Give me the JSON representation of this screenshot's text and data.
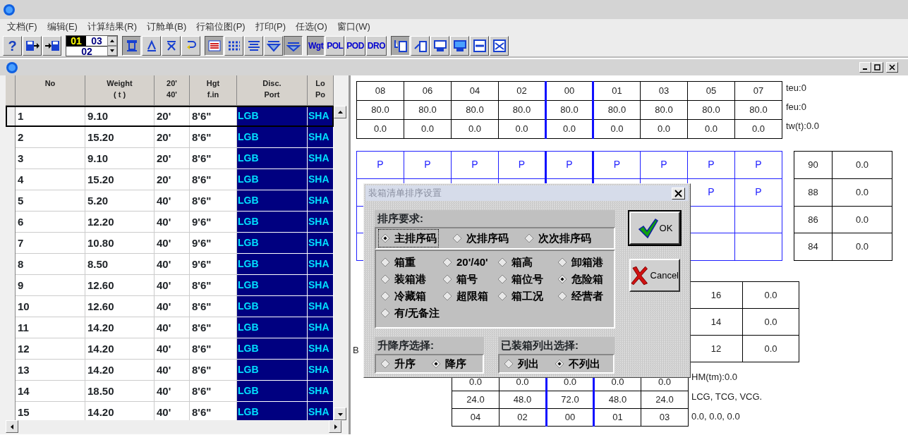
{
  "menu": [
    {
      "label": "文档(F)"
    },
    {
      "label": "编辑(E)"
    },
    {
      "label": "计算结果(R)"
    },
    {
      "label": "订舱单(B)"
    },
    {
      "label": "行箱位图(P)"
    },
    {
      "label": "打印(P)"
    },
    {
      "label": "任选(O)"
    },
    {
      "label": "窗口(W)"
    }
  ],
  "toolbar": [
    {
      "buttons": [
        {
          "kind": "text",
          "label": "?",
          "pressed": false
        },
        {
          "kind": "icon",
          "pressed": false
        },
        {
          "kind": "icon",
          "pressed": false
        }
      ]
    },
    {
      "spinner": {
        "first": "01",
        "second": "03",
        "third": "02"
      }
    },
    {
      "buttons": [
        {
          "kind": "icon",
          "pressed": true
        },
        {
          "kind": "icon",
          "pressed": false
        },
        {
          "kind": "icon",
          "pressed": false
        },
        {
          "kind": "icon",
          "pressed": false
        }
      ]
    },
    {
      "buttons": [
        {
          "kind": "icon",
          "pressed": true
        },
        {
          "kind": "icon",
          "pressed": false
        },
        {
          "kind": "icon",
          "pressed": false
        },
        {
          "kind": "icon",
          "pressed": false
        },
        {
          "kind": "icon",
          "pressed": true
        }
      ]
    },
    {
      "buttons": [
        {
          "kind": "text",
          "label": "Wgt",
          "pressed": true
        },
        {
          "kind": "text",
          "label": "POL",
          "pressed": false
        },
        {
          "kind": "text",
          "label": "POD",
          "pressed": false
        },
        {
          "kind": "text",
          "label": "DRO",
          "pressed": false
        }
      ]
    },
    {
      "buttons": [
        {
          "kind": "icon",
          "pressed": true
        },
        {
          "kind": "icon",
          "pressed": false
        },
        {
          "kind": "icon",
          "pressed": false
        },
        {
          "kind": "icon",
          "pressed": false
        },
        {
          "kind": "icon",
          "pressed": false
        },
        {
          "kind": "icon",
          "pressed": false
        }
      ]
    }
  ],
  "table": {
    "columns": [
      "No",
      "Weight\n( t )",
      "20'\n40'",
      "Hgt\nf.in",
      "Disc.\nPort",
      "Lo\nPo"
    ],
    "rows": [
      {
        "selected": true,
        "cells": [
          "1",
          "9.10",
          "20'",
          "8'6\"",
          "LGB",
          "SHA"
        ]
      },
      {
        "selected": false,
        "cells": [
          "2",
          "15.20",
          "20'",
          "8'6\"",
          "LGB",
          "SHA"
        ]
      },
      {
        "selected": false,
        "cells": [
          "3",
          "9.10",
          "20'",
          "8'6\"",
          "LGB",
          "SHA"
        ]
      },
      {
        "selected": false,
        "cells": [
          "4",
          "15.20",
          "20'",
          "8'6\"",
          "LGB",
          "SHA"
        ]
      },
      {
        "selected": false,
        "cells": [
          "5",
          "5.20",
          "40'",
          "8'6\"",
          "LGB",
          "SHA"
        ]
      },
      {
        "selected": false,
        "cells": [
          "6",
          "12.20",
          "40'",
          "9'6\"",
          "LGB",
          "SHA"
        ]
      },
      {
        "selected": false,
        "cells": [
          "7",
          "10.80",
          "40'",
          "9'6\"",
          "LGB",
          "SHA"
        ]
      },
      {
        "selected": false,
        "cells": [
          "8",
          "8.50",
          "40'",
          "9'6\"",
          "LGB",
          "SHA"
        ]
      },
      {
        "selected": false,
        "cells": [
          "9",
          "12.60",
          "40'",
          "8'6\"",
          "LGB",
          "SHA"
        ]
      },
      {
        "selected": false,
        "cells": [
          "10",
          "12.60",
          "40'",
          "8'6\"",
          "LGB",
          "SHA"
        ]
      },
      {
        "selected": false,
        "cells": [
          "11",
          "14.20",
          "40'",
          "8'6\"",
          "LGB",
          "SHA"
        ]
      },
      {
        "selected": false,
        "cells": [
          "12",
          "14.20",
          "40'",
          "8'6\"",
          "LGB",
          "SHA"
        ]
      },
      {
        "selected": false,
        "cells": [
          "13",
          "14.20",
          "40'",
          "8'6\"",
          "LGB",
          "SHA"
        ]
      },
      {
        "selected": false,
        "cells": [
          "14",
          "18.50",
          "40'",
          "8'6\"",
          "LGB",
          "SHA"
        ]
      },
      {
        "selected": false,
        "cells": [
          "15",
          "14.20",
          "40'",
          "8'6\"",
          "LGB",
          "SHA"
        ]
      }
    ]
  },
  "bay_plan": {
    "top_table": [
      [
        "08",
        "06",
        "04",
        "02",
        "00",
        "01",
        "03",
        "05",
        "07"
      ],
      [
        "80.0",
        "80.0",
        "80.0",
        "80.0",
        "80.0",
        "80.0",
        "80.0",
        "80.0",
        "80.0"
      ],
      [
        "0.0",
        "0.0",
        "0.0",
        "0.0",
        "0.0",
        "0.0",
        "0.0",
        "0.0",
        "0.0"
      ]
    ],
    "totals": [
      "teu:0",
      "feu:0",
      "tw(t):0.0"
    ],
    "slot_grid": [
      [
        "P",
        "P",
        "P",
        "P",
        "P",
        "P",
        "P",
        "P",
        "P"
      ],
      [
        "P",
        "P"
      ]
    ],
    "tier_table": [
      [
        "90",
        "0.0"
      ],
      [
        "88",
        "0.0"
      ],
      [
        "86",
        "0.0"
      ],
      [
        "84",
        "0.0"
      ]
    ],
    "lower_tier_table": [
      [
        "16",
        "0.0"
      ],
      [
        "14",
        "0.0"
      ],
      [
        "12",
        "0.0"
      ]
    ],
    "stray_text": "B",
    "bottom_table": [
      [
        "0.0",
        "0.0",
        "0.0",
        "0.0",
        "0.0"
      ],
      [
        "24.0",
        "48.0",
        "72.0",
        "48.0",
        "24.0"
      ],
      [
        "04",
        "02",
        "00",
        "01",
        "03"
      ]
    ],
    "moments": [
      "HM(tm):0.0",
      "LCG, TCG, VCG.",
      "0.0, 0.0, 0.0"
    ]
  },
  "dialog": {
    "title": "装箱清单排序设置",
    "sort_requirement": {
      "label": "排序要求:",
      "levels": [
        {
          "label": "主排序码",
          "selected": true,
          "focused": true
        },
        {
          "label": "次排序码",
          "selected": false,
          "focused": false
        },
        {
          "label": "次次排序码",
          "selected": false,
          "focused": false
        }
      ],
      "fields": [
        {
          "label": "箱重",
          "selected": false
        },
        {
          "label": "20'/40'",
          "selected": false
        },
        {
          "label": "箱高",
          "selected": false
        },
        {
          "label": "卸箱港",
          "selected": false
        },
        {
          "label": "装箱港",
          "selected": false
        },
        {
          "label": "箱号",
          "selected": false
        },
        {
          "label": "箱位号",
          "selected": false
        },
        {
          "label": "危险箱",
          "selected": true
        },
        {
          "label": "冷藏箱",
          "selected": false
        },
        {
          "label": "超限箱",
          "selected": false
        },
        {
          "label": "箱工况",
          "selected": false
        },
        {
          "label": "经营者",
          "selected": false
        },
        {
          "label": "有/无备注",
          "selected": false
        }
      ]
    },
    "order": {
      "label": "升降序选择:",
      "options": [
        {
          "label": "升序",
          "selected": false
        },
        {
          "label": "降序",
          "selected": true
        }
      ]
    },
    "listing": {
      "label": "已装箱列出选择:",
      "options": [
        {
          "label": "列出",
          "selected": false
        },
        {
          "label": "不列出",
          "selected": true
        }
      ]
    },
    "buttons": [
      {
        "kind": "ok",
        "label": "OK"
      },
      {
        "kind": "cancel",
        "label": "Cancel"
      }
    ]
  }
}
